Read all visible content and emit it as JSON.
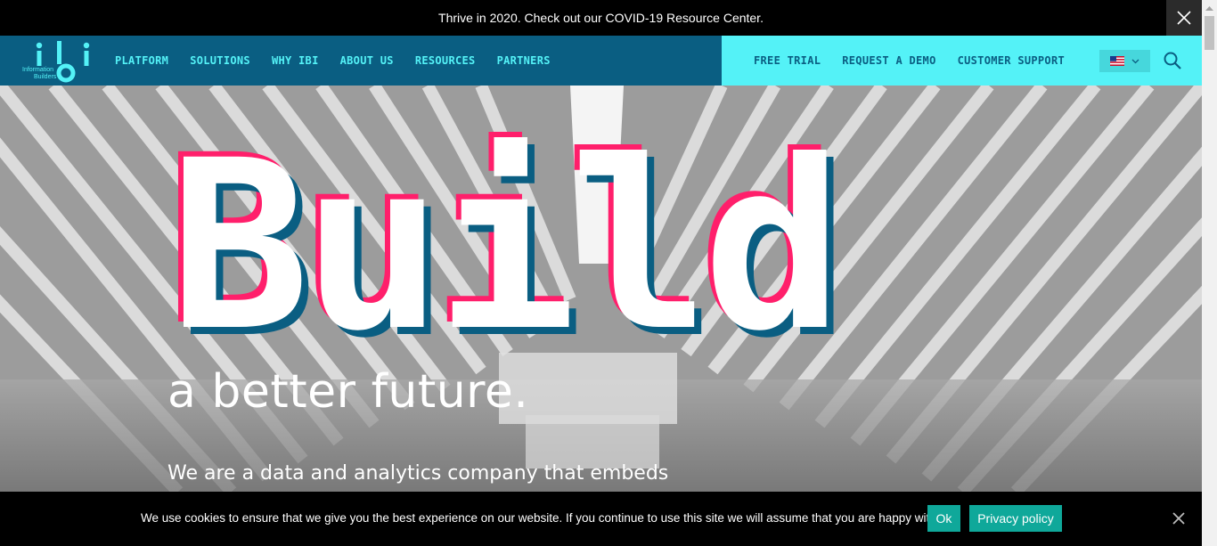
{
  "announcement": {
    "text": "Thrive in 2020. Check out our COVID-19 Resource Center.",
    "close_icon": "close-icon"
  },
  "logo": {
    "mark": "ibi",
    "line1": "Information",
    "line2": "Builders"
  },
  "nav": {
    "items": [
      {
        "label": "PLATFORM"
      },
      {
        "label": "SOLUTIONS"
      },
      {
        "label": "WHY IBI"
      },
      {
        "label": "ABOUT US"
      },
      {
        "label": "RESOURCES"
      },
      {
        "label": "PARTNERS"
      }
    ],
    "right_items": [
      {
        "label": "FREE TRIAL"
      },
      {
        "label": "REQUEST A DEMO"
      },
      {
        "label": "CUSTOMER SUPPORT"
      }
    ],
    "language_icon": "us-flag-icon",
    "search_icon": "search-icon"
  },
  "hero": {
    "headline": "Build",
    "tagline": "a better future.",
    "subline": "We are a data and analytics company that embeds"
  },
  "cookie": {
    "text": "We use cookies to ensure that we give you the best experience on our website. If you continue to use this site we will assume that you are happy with it.",
    "ok_label": "Ok",
    "privacy_label": "Privacy policy"
  },
  "colors": {
    "nav_blue": "#0a5e82",
    "accent_cyan": "#54f2f7",
    "accent_pink": "#ff1f6b",
    "cookie_button": "#0fa89a"
  }
}
